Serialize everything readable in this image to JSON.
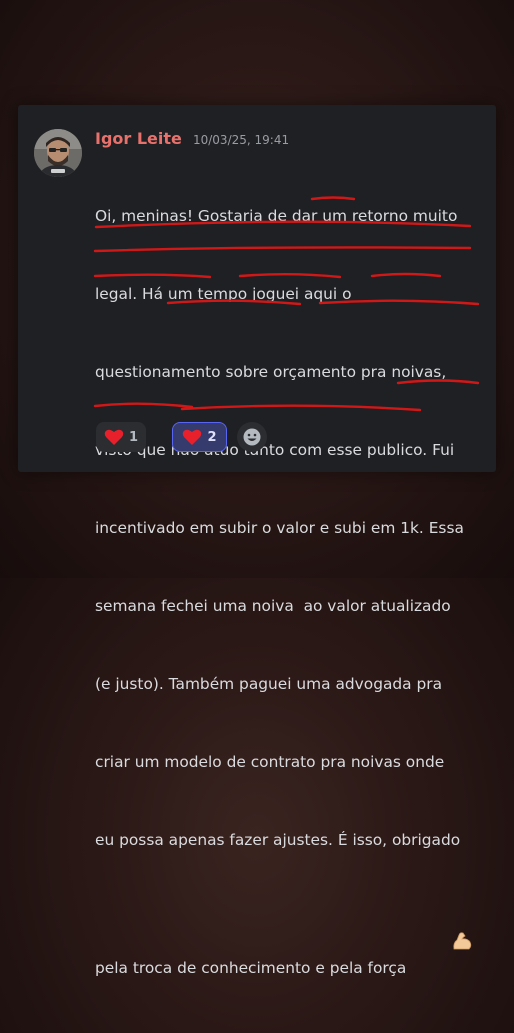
{
  "message": {
    "author": "Igor Leite",
    "timestamp": "10/03/25, 19:41",
    "lines": [
      "Oi, meninas! Gostaria de dar um retorno muito",
      "legal. Há um tempo joguei aqui o",
      "questionamento sobre orçamento pra noivas,",
      "visto que não atuo tanto com esse publico. Fui",
      "incentivado em subir o valor e subi em 1k. Essa",
      "semana fechei uma noiva  ao valor atualizado",
      "(e justo). Também paguei uma advogada pra",
      "criar um modelo de contrato pra noivas onde",
      "eu possa apenas fazer ajustes. É isso, obrigado",
      "pela troca de conhecimento e pela força"
    ],
    "inline_emoji": "flexed-biceps-icon",
    "annotation_color": "#d01818"
  },
  "reactions": [
    {
      "emoji": "heart-icon",
      "count": "1",
      "active": false
    },
    {
      "emoji": "heart-icon",
      "count": "2",
      "active": true
    },
    {
      "emoji": "add-reaction-icon",
      "count": "",
      "active": false
    }
  ],
  "colors": {
    "background": "#1f2024",
    "username": "#e8716c",
    "text": "#dadbde",
    "timestamp": "#9a9ca3",
    "reaction_active_border": "#5865f2",
    "reaction_active_bg": "#353b6c",
    "reaction_bg": "#2b2d31"
  }
}
